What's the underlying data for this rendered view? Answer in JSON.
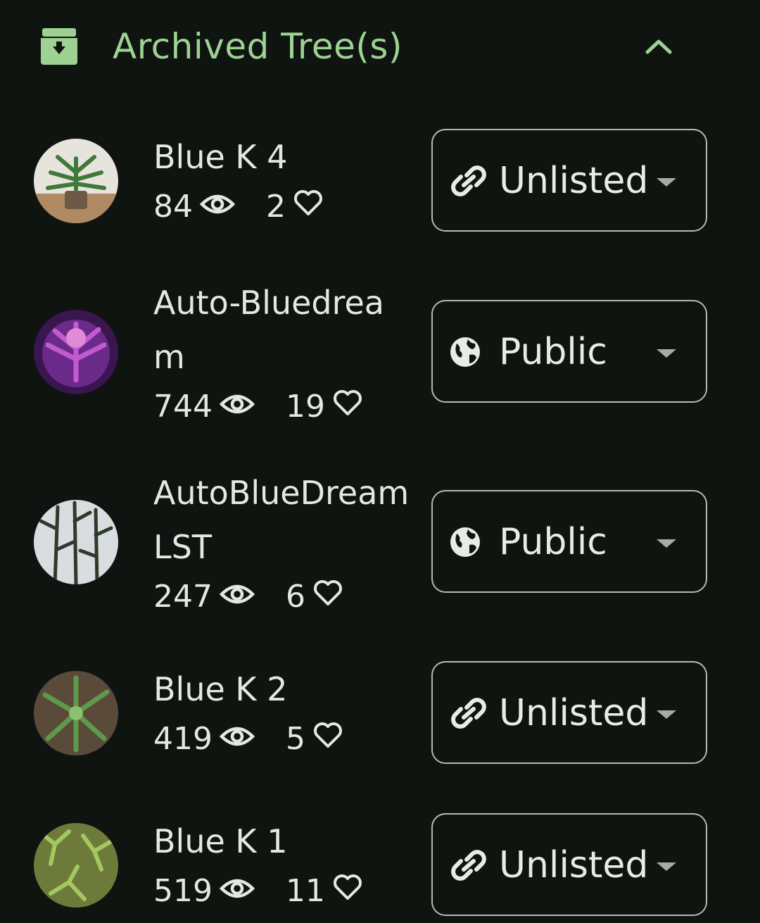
{
  "header": {
    "title": "Archived Tree(s)",
    "accent_color": "#9ed293",
    "icon": "archive-box-icon",
    "toggle_icon": "chevron-up-icon"
  },
  "trees": [
    {
      "name": "Blue K 4",
      "views": "84",
      "likes": "2",
      "visibility": "Unlisted",
      "visibility_icon": "link-icon"
    },
    {
      "name": "Auto-Bluedream",
      "views": "744",
      "likes": "19",
      "visibility": "Public",
      "visibility_icon": "globe-icon"
    },
    {
      "name": "AutoBlueDream LST",
      "views": "247",
      "likes": "6",
      "visibility": "Public",
      "visibility_icon": "globe-icon"
    },
    {
      "name": "Blue K 2",
      "views": "419",
      "likes": "5",
      "visibility": "Unlisted",
      "visibility_icon": "link-icon"
    },
    {
      "name": "Blue K 1",
      "views": "519",
      "likes": "11",
      "visibility": "Unlisted",
      "visibility_icon": "link-icon"
    }
  ],
  "stat_icons": {
    "views": "eye-icon",
    "likes": "heart-icon"
  },
  "dropdown_icon": "caret-down-icon"
}
